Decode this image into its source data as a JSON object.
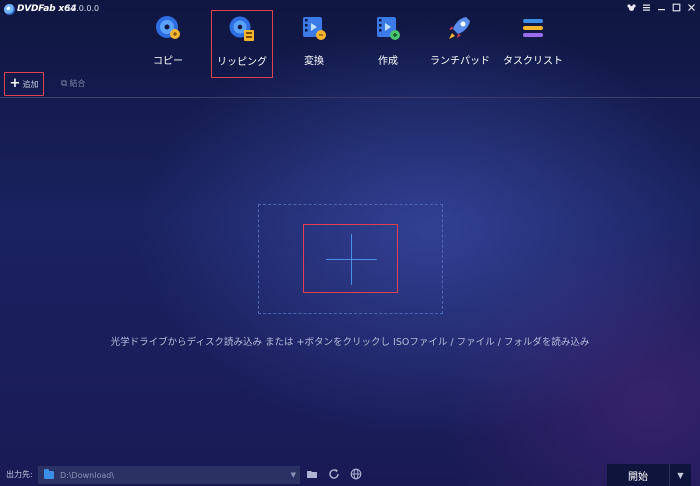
{
  "app": {
    "logo_text": "DVDFab",
    "arch": "x64",
    "version": "12.0.0.0"
  },
  "window_controls": [
    "mascot-icon",
    "menu-icon",
    "minimize-icon",
    "maximize-icon",
    "close-icon"
  ],
  "nav": {
    "items": [
      {
        "label": "コピー",
        "icon": "disc-copy-icon"
      },
      {
        "label": "リッピング",
        "icon": "disc-ripper-icon",
        "active": true
      },
      {
        "label": "変換",
        "icon": "film-converter-icon"
      },
      {
        "label": "作成",
        "icon": "film-creator-icon"
      },
      {
        "label": "ランチパッド",
        "icon": "rocket-icon"
      },
      {
        "label": "タスクリスト",
        "icon": "task-list-icon"
      }
    ]
  },
  "toolbar": {
    "add_label": "追加",
    "merge_label": "結合"
  },
  "main": {
    "hint": "光学ドライブからディスク読み込み または +ボタンをクリックし ISOファイル / ファイル / フォルダを読み込み"
  },
  "bottom": {
    "output_label": "出力先:",
    "output_path": "D:\\Download\\",
    "start_label": "開始"
  },
  "colors": {
    "highlight_border": "#e0414b",
    "accent_blue": "#4a8fe8"
  }
}
